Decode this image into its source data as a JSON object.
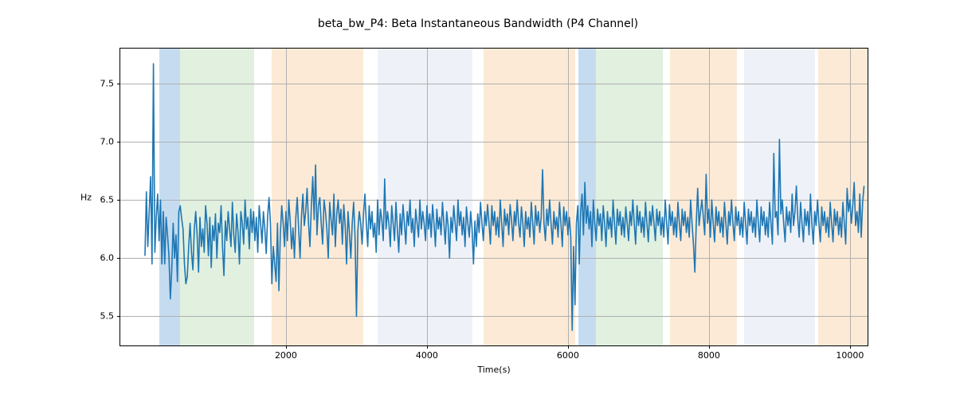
{
  "chart_data": {
    "type": "line",
    "title": "beta_bw_P4: Beta Instantaneous Bandwidth (P4 Channel)",
    "xlabel": "Time(s)",
    "ylabel": "Hz",
    "xlim": [
      -350,
      10250
    ],
    "ylim": [
      5.25,
      7.8
    ],
    "x_ticks": [
      2000,
      4000,
      6000,
      8000,
      10000
    ],
    "y_ticks": [
      5.5,
      6.0,
      6.5,
      7.0,
      7.5
    ],
    "line_color": "#1f77b4",
    "bands": [
      {
        "x0": 200,
        "x1": 500,
        "color": "#5a9bd4"
      },
      {
        "x0": 500,
        "x1": 1550,
        "color": "#a8d5a2"
      },
      {
        "x0": 1800,
        "x1": 3100,
        "color": "#f7c38a"
      },
      {
        "x0": 3300,
        "x1": 4650,
        "color": "#cddbea"
      },
      {
        "x0": 4800,
        "x1": 6100,
        "color": "#f7c38a"
      },
      {
        "x0": 6150,
        "x1": 6400,
        "color": "#5a9bd4"
      },
      {
        "x0": 6400,
        "x1": 7350,
        "color": "#a8d5a2"
      },
      {
        "x0": 7450,
        "x1": 8400,
        "color": "#f7c38a"
      },
      {
        "x0": 8500,
        "x1": 9500,
        "color": "#cddbea"
      },
      {
        "x0": 9550,
        "x1": 10250,
        "color": "#f7c38a"
      }
    ],
    "series": [
      {
        "name": "beta_bw_P4",
        "x_step": 20,
        "x_start": 0,
        "values": [
          6.02,
          6.57,
          6.1,
          6.4,
          6.7,
          5.95,
          7.67,
          6.05,
          6.35,
          6.55,
          6.15,
          6.5,
          5.95,
          6.4,
          5.95,
          6.35,
          6.2,
          6.02,
          5.65,
          5.9,
          6.3,
          6.0,
          6.2,
          5.8,
          6.4,
          6.45,
          6.34,
          6.25,
          5.95,
          5.78,
          5.84,
          6.1,
          6.3,
          6.05,
          5.9,
          6.25,
          6.4,
          6.2,
          5.88,
          6.35,
          6.1,
          6.25,
          6.05,
          6.45,
          6.3,
          6.02,
          6.35,
          5.92,
          6.28,
          6.15,
          6.38,
          6.0,
          6.3,
          6.22,
          6.45,
          6.1,
          5.85,
          6.32,
          6.15,
          6.4,
          6.25,
          6.1,
          6.48,
          6.2,
          6.05,
          6.38,
          6.22,
          5.95,
          6.4,
          6.3,
          6.12,
          6.5,
          6.25,
          6.35,
          6.08,
          6.42,
          6.22,
          6.4,
          6.15,
          6.35,
          6.05,
          6.45,
          6.3,
          6.13,
          6.4,
          6.25,
          6.04,
          6.36,
          6.52,
          6.3,
          5.78,
          6.1,
          5.95,
          5.8,
          6.3,
          5.72,
          6.2,
          6.45,
          6.3,
          6.1,
          6.4,
          6.15,
          6.5,
          6.32,
          6.08,
          6.26,
          6.0,
          6.35,
          6.52,
          6.25,
          6.0,
          6.36,
          6.55,
          6.28,
          6.4,
          6.6,
          6.3,
          6.1,
          6.45,
          6.7,
          6.33,
          6.8,
          6.2,
          6.45,
          6.52,
          6.3,
          6.12,
          6.5,
          6.4,
          6.25,
          6.0,
          6.48,
          6.33,
          6.2,
          6.55,
          6.1,
          6.38,
          6.5,
          6.3,
          6.42,
          6.12,
          6.46,
          6.28,
          5.95,
          6.4,
          6.22,
          6.0,
          6.3,
          6.48,
          6.18,
          5.5,
          6.24,
          6.4,
          6.3,
          6.12,
          6.38,
          6.55,
          6.3,
          6.1,
          6.45,
          6.25,
          6.4,
          6.18,
          6.3,
          6.05,
          6.5,
          6.2,
          6.42,
          6.33,
          6.15,
          6.68,
          6.25,
          6.4,
          6.3,
          6.1,
          6.45,
          6.3,
          6.15,
          6.48,
          6.25,
          6.05,
          6.38,
          6.2,
          6.46,
          6.3,
          6.12,
          6.4,
          6.28,
          6.5,
          6.22,
          6.34,
          6.1,
          6.42,
          6.3,
          6.18,
          6.5,
          6.25,
          6.4,
          6.3,
          6.15,
          6.45,
          6.25,
          6.38,
          6.18,
          6.46,
          6.3,
          6.1,
          6.42,
          6.25,
          6.35,
          6.2,
          6.48,
          6.3,
          6.12,
          6.4,
          6.28,
          6.0,
          6.35,
          6.22,
          6.45,
          6.3,
          6.15,
          6.5,
          6.28,
          6.4,
          6.2,
          6.35,
          6.1,
          6.44,
          6.3,
          6.18,
          6.4,
          6.25,
          5.95,
          6.32,
          6.1,
          6.38,
          6.22,
          6.48,
          6.3,
          6.15,
          6.4,
          6.28,
          6.46,
          6.3,
          6.12,
          6.45,
          6.28,
          6.4,
          6.2,
          6.35,
          6.18,
          6.5,
          6.3,
          6.1,
          6.42,
          6.28,
          6.38,
          6.2,
          6.46,
          6.32,
          6.15,
          6.4,
          6.28,
          6.5,
          6.3,
          6.18,
          6.44,
          6.3,
          6.1,
          6.4,
          6.25,
          6.35,
          6.18,
          6.48,
          6.3,
          6.12,
          6.45,
          6.28,
          6.4,
          6.22,
          6.35,
          6.76,
          6.3,
          6.15,
          6.42,
          6.28,
          6.5,
          6.3,
          6.12,
          6.4,
          6.25,
          6.35,
          6.18,
          6.48,
          6.3,
          6.1,
          6.44,
          6.28,
          6.4,
          6.2,
          6.35,
          6.18,
          5.38,
          6.1,
          5.6,
          6.3,
          6.45,
          5.95,
          6.4,
          6.55,
          6.2,
          6.65,
          6.3,
          6.45,
          6.25,
          6.4,
          6.1,
          6.5,
          6.3,
          6.15,
          6.42,
          6.28,
          6.38,
          6.15,
          6.45,
          6.3,
          6.1,
          6.4,
          6.25,
          6.35,
          6.18,
          6.5,
          6.3,
          6.12,
          6.42,
          6.28,
          6.4,
          6.2,
          6.35,
          6.18,
          6.44,
          6.3,
          6.15,
          6.4,
          6.28,
          6.5,
          6.3,
          6.12,
          6.45,
          6.28,
          6.4,
          6.22,
          6.35,
          6.18,
          6.48,
          6.3,
          6.14,
          6.4,
          6.28,
          6.45,
          6.3,
          6.15,
          6.42,
          6.28,
          6.4,
          6.2,
          6.35,
          6.18,
          6.5,
          6.3,
          6.12,
          6.46,
          6.28,
          6.4,
          6.2,
          6.35,
          6.18,
          6.48,
          6.3,
          6.15,
          6.42,
          6.28,
          6.4,
          6.22,
          6.35,
          6.18,
          6.5,
          6.3,
          6.12,
          5.88,
          6.3,
          6.6,
          6.28,
          6.4,
          6.5,
          6.35,
          6.2,
          6.72,
          6.3,
          6.42,
          6.18,
          6.5,
          6.3,
          6.14,
          6.44,
          6.28,
          6.4,
          6.22,
          6.35,
          6.18,
          6.48,
          6.3,
          6.12,
          6.4,
          6.28,
          6.5,
          6.3,
          6.15,
          6.44,
          6.28,
          6.4,
          6.2,
          6.35,
          6.18,
          6.48,
          6.3,
          6.12,
          6.42,
          6.28,
          6.4,
          6.22,
          6.35,
          6.18,
          6.5,
          6.3,
          6.14,
          6.44,
          6.28,
          6.4,
          6.2,
          6.35,
          6.18,
          6.48,
          6.3,
          6.12,
          6.9,
          6.35,
          6.4,
          6.2,
          7.02,
          6.38,
          6.5,
          6.3,
          6.14,
          6.44,
          6.28,
          6.4,
          6.22,
          6.55,
          6.28,
          6.4,
          6.62,
          6.34,
          6.18,
          6.48,
          6.3,
          6.14,
          6.42,
          6.28,
          6.4,
          6.2,
          6.55,
          6.3,
          6.12,
          6.4,
          6.28,
          6.5,
          6.3,
          6.14,
          6.44,
          6.28,
          6.4,
          6.22,
          6.35,
          6.18,
          6.48,
          6.3,
          6.14,
          6.42,
          6.28,
          6.4,
          6.2,
          6.35,
          6.18,
          6.48,
          6.3,
          6.12,
          6.6,
          6.4,
          6.5,
          6.3,
          6.45,
          6.65,
          6.28,
          6.4,
          6.22,
          6.55,
          6.18,
          6.48,
          6.62
        ]
      }
    ]
  }
}
